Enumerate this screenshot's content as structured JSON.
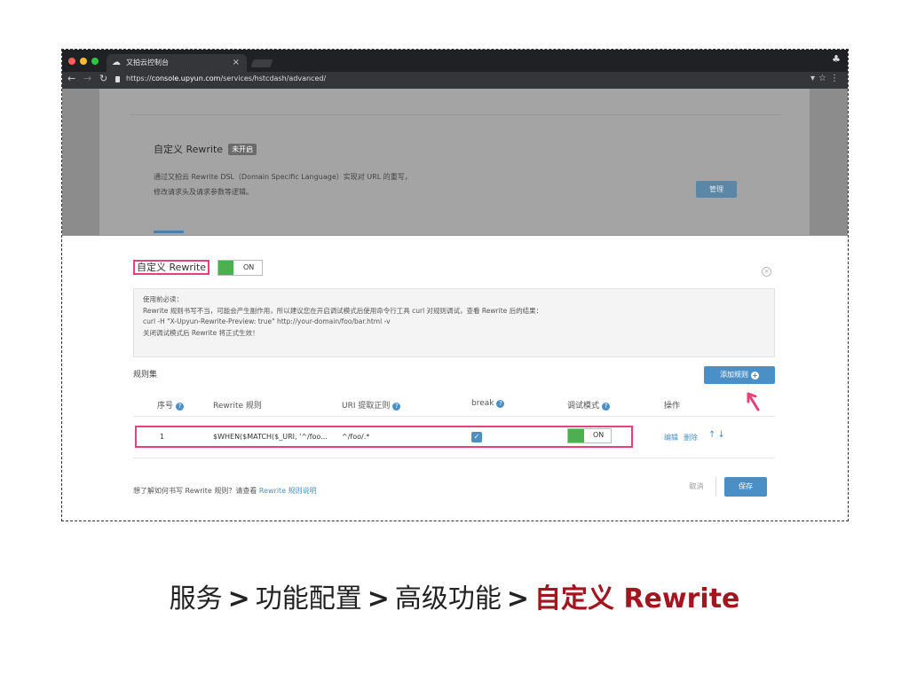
{
  "browser": {
    "tab_title": "又拍云控制台",
    "url_scheme": "https://",
    "url_host": "console.upyun.com",
    "url_path": "/services/hstcdash/advanced/"
  },
  "background_card": {
    "title": "自定义 Rewrite",
    "status_badge": "未开启",
    "desc_line1": "通过又拍云 Rewrite DSL（Domain Specific Language）实现对 URL 的重写，",
    "desc_line2": "修改请求头及请求参数等逻辑。",
    "manage_label": "管理"
  },
  "modal": {
    "title": "自定义 Rewrite",
    "toggle_label": "ON",
    "notice": {
      "heading": "使用前必读：",
      "line1": "Rewrite 规则书写不当，可能会产生副作用，所以建议您在开启调试模式后使用命令行工具 curl 对规则调试，查看 Rewrite 后的结果：",
      "line2": "curl -H \"X-Upyun-Rewrite-Preview: true\" http://your-domain/foo/bar.html -v",
      "line3": "关闭调试模式后 Rewrite 将正式生效！"
    },
    "rules_label": "规则集",
    "add_rule_label": "添加规则",
    "columns": {
      "index": "序号",
      "rule": "Rewrite 规则",
      "uri_match": "URI 提取正则",
      "break": "break",
      "debug": "调试模式",
      "ops": "操作"
    },
    "rows": [
      {
        "index": "1",
        "rule": "$WHEN($MATCH($_URI, '^/foo...",
        "uri_match": "^/foo/.*",
        "break_checked": "✓",
        "debug_toggle": "ON",
        "edit": "编辑",
        "delete": "删除"
      }
    ],
    "footer_text": "想了解如何书写 Rewrite 规则？请查看",
    "footer_link": "Rewrite 规则说明",
    "cancel_label": "取消",
    "save_label": "保存"
  },
  "caption": {
    "part1": "服务",
    "part2": "功能配置",
    "part3": "高级功能",
    "current": "自定义 Rewrite",
    "separator": ">"
  },
  "colors": {
    "highlight": "#e8417a",
    "primary": "#4a90c7",
    "toggle_on": "#4caf50",
    "caption_current": "#a3161f"
  }
}
